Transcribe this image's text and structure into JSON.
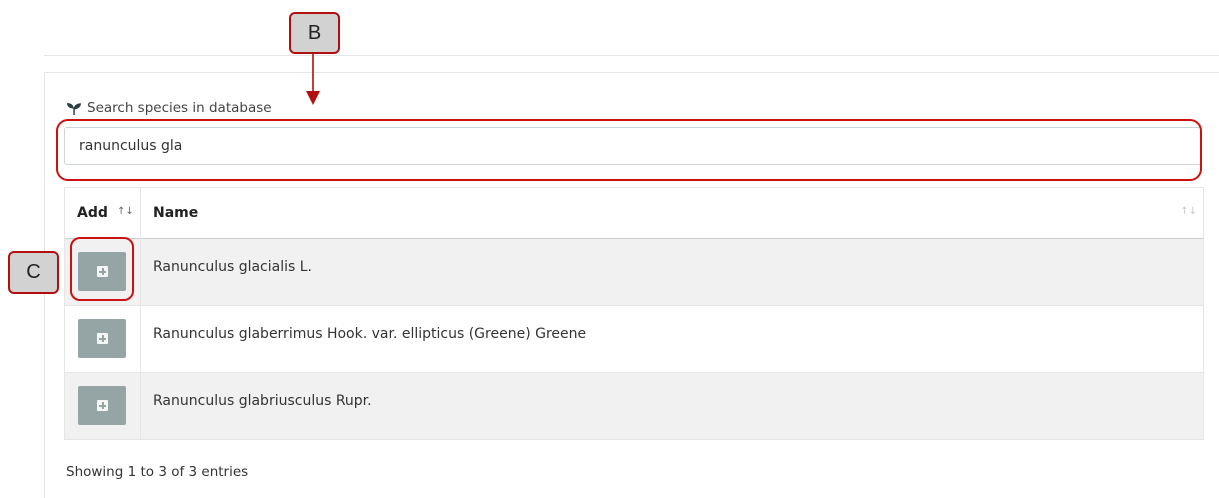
{
  "search": {
    "label": "Search species in database",
    "value": "ranunculus gla",
    "icon": "seedling-icon"
  },
  "table": {
    "headers": {
      "add": "Add",
      "name": "Name"
    },
    "sort_icon": "sort-arrows-icon",
    "rows": [
      {
        "name": "Ranunculus glacialis L."
      },
      {
        "name": "Ranunculus glaberrimus Hook. var. ellipticus (Greene) Greene"
      },
      {
        "name": "Ranunculus glabriusculus Rupr."
      }
    ],
    "add_button_icon": "plus-square-icon",
    "info": "Showing 1 to 3 of 3 entries"
  },
  "annotations": {
    "search_callout": "B",
    "add_callout": "C",
    "highlight_color": "#cc1111"
  },
  "colors": {
    "add_button": "#95a5a6",
    "stripe": "#f1f1f1"
  }
}
